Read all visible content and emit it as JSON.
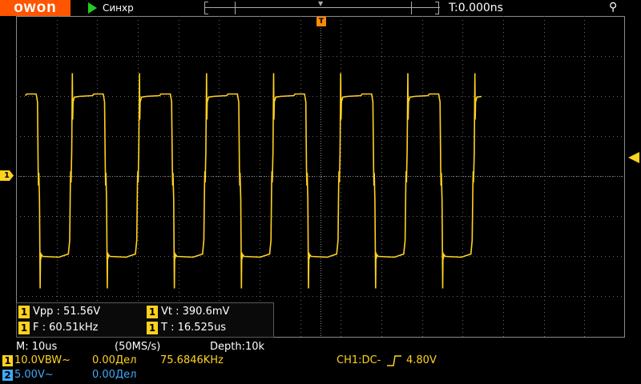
{
  "header": {
    "logo": "owon",
    "run_state": "Синхр",
    "trigger_time": "T:0.000ns",
    "usb_icon": "usb-icon",
    "run_icon": "play-icon"
  },
  "colors": {
    "ch1": "#ffd21e",
    "ch2": "#3fa9f5",
    "trigger": "#ff8c00",
    "logo_bg": "#ff5400",
    "run_icon": "#22cc22"
  },
  "markers": {
    "trigger_pos": "T",
    "ch1_ground": "1"
  },
  "measurements": {
    "vpp_ch": "1",
    "vpp": "Vpp : 51.56V",
    "vt_ch": "1",
    "vt": "Vt : 390.6mV",
    "f_ch": "1",
    "f": "F : 60.51kHz",
    "t_ch": "1",
    "t": "T : 16.525us"
  },
  "timebase": {
    "main": "M: 10us",
    "sample_rate": "(50MS/s)",
    "depth": "Depth:10k"
  },
  "ch1": {
    "num": "1",
    "scale": "10.0VBW~",
    "offset": "0.00Дел",
    "freq": "75.6846KHz",
    "trigger": "CH1:DC-",
    "trigger_level": "4.80V"
  },
  "ch2": {
    "num": "2",
    "scale": "5.00V~",
    "offset": "0.00Дел"
  },
  "waveform": {
    "period_us": 16.525,
    "vpp_v": 51.56,
    "time_per_div_us": 10
  }
}
